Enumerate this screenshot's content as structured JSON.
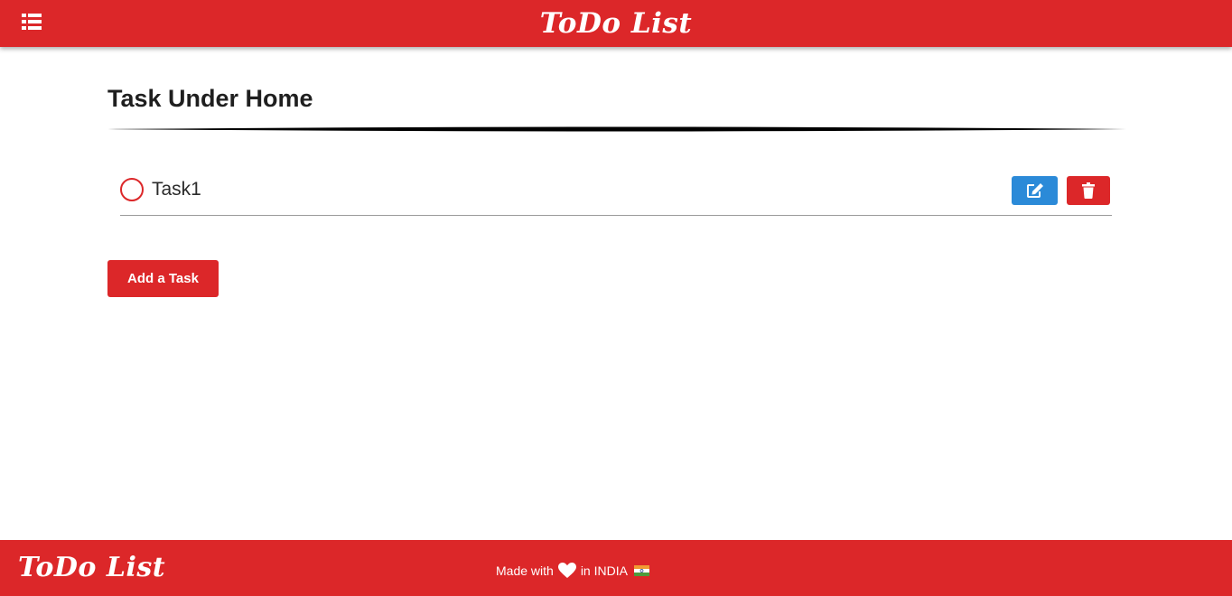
{
  "header": {
    "brand": "ToDo List",
    "menu_icon": "list-icon",
    "background_color": "#dc2729"
  },
  "main": {
    "title": "Task Under Home",
    "tasks": [
      {
        "label": "Task1",
        "done": false,
        "edit_icon": "edit-icon",
        "delete_icon": "trash-icon"
      }
    ],
    "add_button_label": "Add a Task"
  },
  "footer": {
    "brand": "ToDo List",
    "made_with": "Made with",
    "heart_icon": "heart-icon",
    "location": "in INDIA",
    "flag_icon": "india-flag-icon"
  },
  "colors": {
    "accent": "#dc2729",
    "edit_button": "#2b8ad8"
  }
}
